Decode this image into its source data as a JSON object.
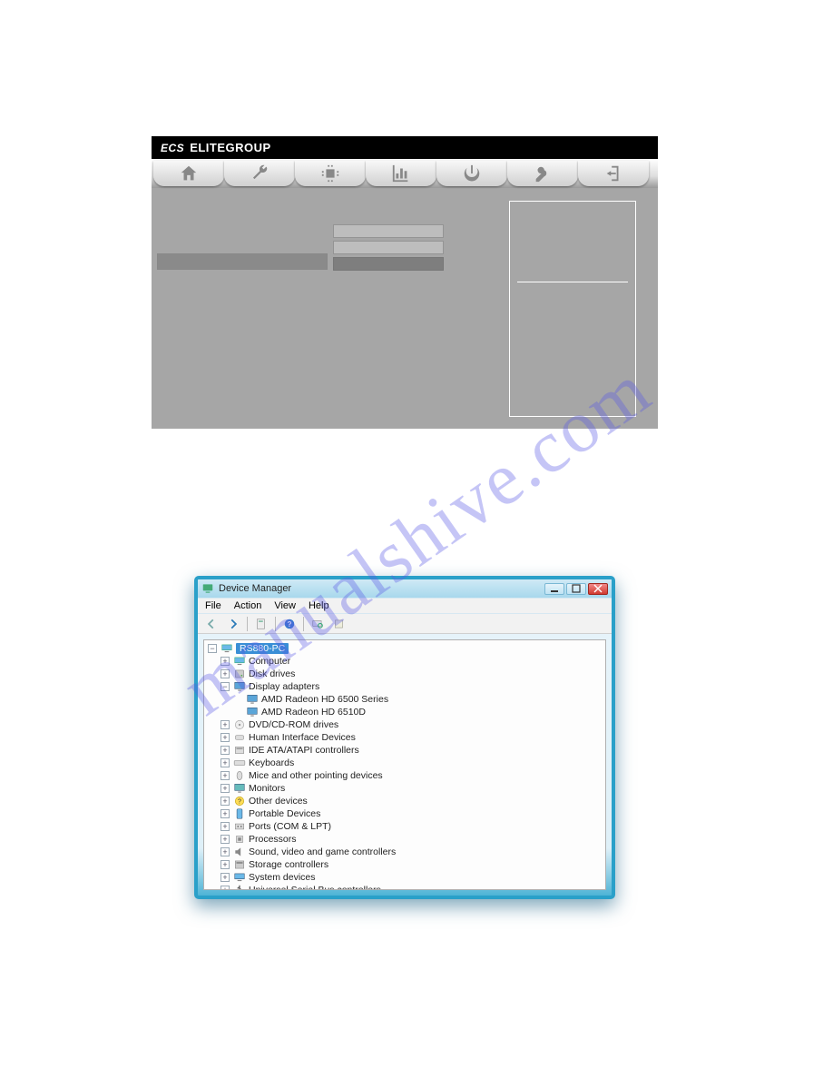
{
  "watermark": "manualshive.com",
  "bios": {
    "brand_prefix": "ECS",
    "brand": "ELITEGROUP",
    "tab_icons": [
      "home-icon",
      "wrench-icon",
      "chip-icon",
      "chart-icon",
      "power-icon",
      "key-icon",
      "exit-icon"
    ]
  },
  "dm": {
    "title": "Device Manager",
    "menu": [
      "File",
      "Action",
      "View",
      "Help"
    ],
    "root": "RS880-PC",
    "nodes": [
      {
        "depth": 1,
        "exp": "+",
        "icon": "computer",
        "label": "Computer"
      },
      {
        "depth": 1,
        "exp": "+",
        "icon": "disk",
        "label": "Disk drives"
      },
      {
        "depth": 1,
        "exp": "-",
        "icon": "display",
        "label": "Display adapters"
      },
      {
        "depth": 2,
        "exp": "",
        "icon": "gpu",
        "label": "AMD Radeon HD 6500 Series"
      },
      {
        "depth": 2,
        "exp": "",
        "icon": "gpu",
        "label": "AMD Radeon HD 6510D"
      },
      {
        "depth": 1,
        "exp": "+",
        "icon": "dvd",
        "label": "DVD/CD-ROM drives"
      },
      {
        "depth": 1,
        "exp": "+",
        "icon": "hid",
        "label": "Human Interface Devices"
      },
      {
        "depth": 1,
        "exp": "+",
        "icon": "ide",
        "label": "IDE ATA/ATAPI controllers"
      },
      {
        "depth": 1,
        "exp": "+",
        "icon": "kbd",
        "label": "Keyboards"
      },
      {
        "depth": 1,
        "exp": "+",
        "icon": "mouse",
        "label": "Mice and other pointing devices"
      },
      {
        "depth": 1,
        "exp": "+",
        "icon": "monitor",
        "label": "Monitors"
      },
      {
        "depth": 1,
        "exp": "+",
        "icon": "other",
        "label": "Other devices"
      },
      {
        "depth": 1,
        "exp": "+",
        "icon": "portable",
        "label": "Portable Devices"
      },
      {
        "depth": 1,
        "exp": "+",
        "icon": "ports",
        "label": "Ports (COM & LPT)"
      },
      {
        "depth": 1,
        "exp": "+",
        "icon": "cpu",
        "label": "Processors"
      },
      {
        "depth": 1,
        "exp": "+",
        "icon": "sound",
        "label": "Sound, video and game controllers"
      },
      {
        "depth": 1,
        "exp": "+",
        "icon": "storage",
        "label": "Storage controllers"
      },
      {
        "depth": 1,
        "exp": "+",
        "icon": "system",
        "label": "System devices"
      },
      {
        "depth": 1,
        "exp": "+",
        "icon": "usb",
        "label": "Universal Serial Bus controllers"
      }
    ]
  }
}
